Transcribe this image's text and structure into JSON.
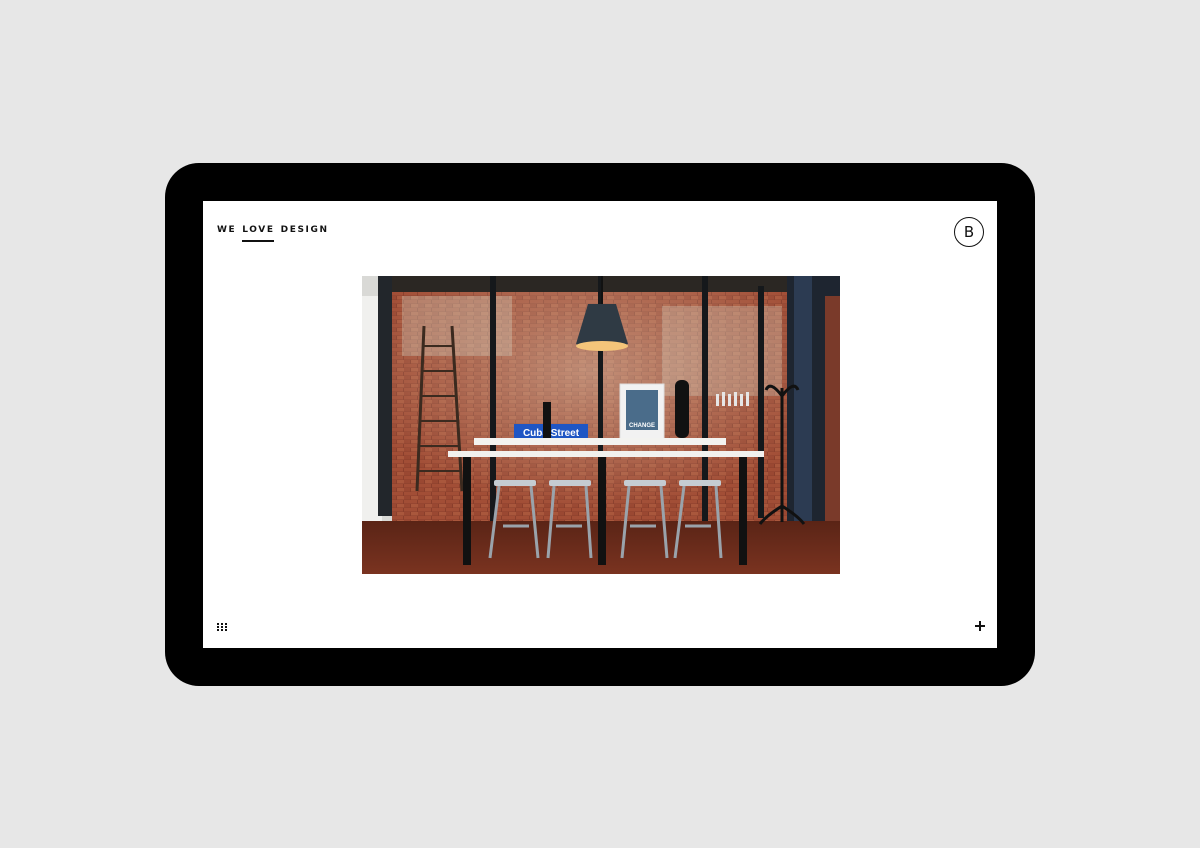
{
  "header": {
    "nav": [
      {
        "label": "WE"
      },
      {
        "label": "LOVE",
        "active": true
      },
      {
        "label": "DESIGN"
      }
    ],
    "logo_letter": "B"
  },
  "main": {
    "photo_sign_text": "Cuba Street",
    "photo_poster_text": "CHANGE"
  },
  "footer": {
    "left_icon": "grid-icon",
    "right_icon": "plus-icon"
  },
  "colors": {
    "page_bg": "#e7e7e7",
    "device_frame": "#000000",
    "screen_bg": "#ffffff",
    "text": "#111111"
  }
}
